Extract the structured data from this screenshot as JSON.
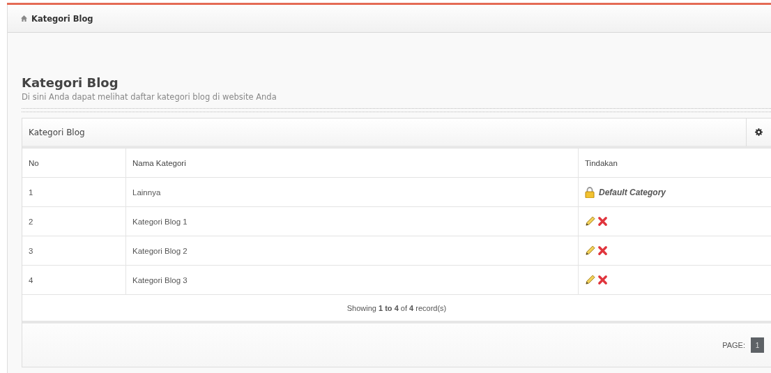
{
  "breadcrumb": {
    "label": "Kategori Blog"
  },
  "page_header": {
    "title": "Kategori Blog",
    "subtitle": "Di sini Anda dapat melihat daftar kategori blog di website Anda"
  },
  "panel": {
    "title": "Kategori Blog"
  },
  "table": {
    "columns": [
      "No",
      "Nama Kategori",
      "Tindakan"
    ],
    "rows": [
      {
        "no": "1",
        "name": "Lainnya",
        "action": {
          "kind": "locked",
          "label": "Default Category"
        }
      },
      {
        "no": "2",
        "name": "Kategori Blog 1",
        "action": {
          "kind": "edit_delete"
        }
      },
      {
        "no": "3",
        "name": "Kategori Blog 2",
        "action": {
          "kind": "edit_delete"
        }
      },
      {
        "no": "4",
        "name": "Kategori Blog 3",
        "action": {
          "kind": "edit_delete"
        }
      }
    ],
    "summary": "Showing **1 to 4** of **4** record(s)"
  },
  "pagination": {
    "label": "PAGE:",
    "pages": [
      {
        "label": "1",
        "selected": true
      }
    ]
  }
}
